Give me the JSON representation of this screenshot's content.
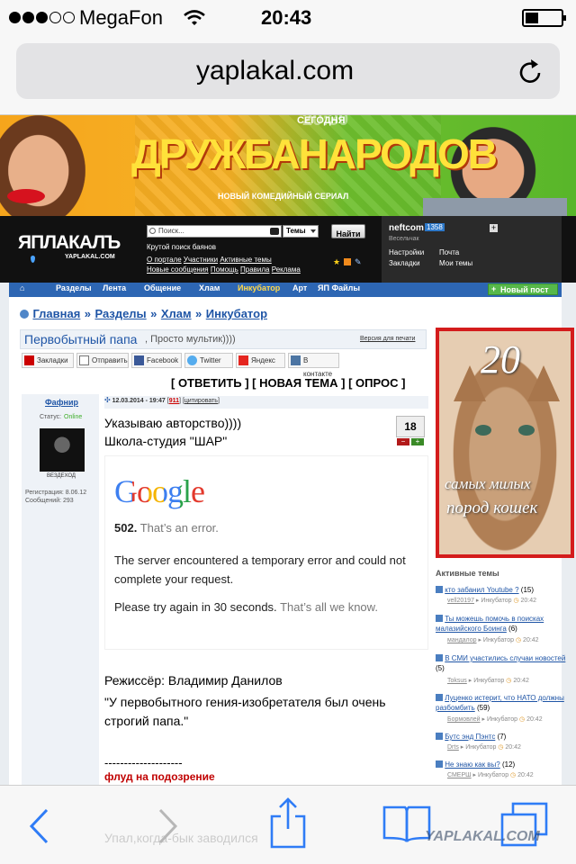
{
  "status_bar": {
    "carrier": "MegaFon",
    "time": "20:43"
  },
  "url_bar": {
    "domain": "yaplakal.com"
  },
  "banner": {
    "small_top": "20:30",
    "today": "СЕГОДНЯ",
    "title": "ДРУЖБАНАРОДОВ",
    "subtitle": "НОВЫЙ КОМЕДИЙНЫЙ СЕРИАЛ"
  },
  "header": {
    "logo": "ЯПЛАКАЛЪ",
    "logo_sub": "YAPLAKAL.COM",
    "search_placeholder": "Поиск...",
    "search_scope": "Темы",
    "search_button": "Найти",
    "search_tagline": "Крутой поиск баянов",
    "links_row1": [
      "О портале",
      "Участники",
      "Активные темы"
    ],
    "links_row2": [
      "Новые сообщения",
      "Помощь",
      "Правила",
      "Реклама"
    ],
    "user": {
      "name": "neftcom",
      "score": "1358",
      "rank": "Весельчак",
      "settings": "Настройки",
      "bookmarks": "Закладки",
      "mail": "Почта",
      "my_topics": "Мои темы"
    }
  },
  "nav": {
    "items": [
      "Разделы",
      "Лента",
      "Общение",
      "Хлам",
      "Инкубатор",
      "Арт",
      "ЯП Файлы"
    ],
    "new_post": "Новый пост"
  },
  "breadcrumb": {
    "items": [
      "Главная",
      "Разделы",
      "Хлам",
      "Инкубатор"
    ],
    "sep": "»"
  },
  "topic": {
    "title": "Первобытный папа",
    "subtitle": ", Просто мультик))))",
    "print_version": "Версия для печати",
    "share_buttons": [
      "Закладки",
      "Отправить",
      "Facebook",
      "Twitter",
      "Яндекс",
      "В контакте"
    ],
    "actions": "[ ОТВЕТИТЬ ] [ НОВАЯ ТЕМА ] [ ОПРОС ]"
  },
  "post": {
    "author": "Фафнир",
    "status_label": "Статус:",
    "status_value": "Online",
    "author_rank": "ВЕЗДЕХОД",
    "registration": "Регистрация: 8.06.12",
    "messages": "Сообщений: 293",
    "date": "12.03.2014 - 19:47",
    "post_id": "911",
    "quote_link": "цитировать",
    "rating": "18",
    "line1": "Указываю авторство))))",
    "line2": "Школа-студия \"ШАР\"",
    "error_logo": "Google",
    "error_code": "502.",
    "error_title": "That’s an error.",
    "error_text": "The server encountered a temporary error and could not complete your request.",
    "error_retry": "Please try again in 30 seconds.",
    "error_retry_tail": "That’s all we know.",
    "director": "Режиссёр: Владимир Данилов",
    "quote": "\"У первобытного гения-изобретателя был очень строгий папа.\"",
    "dashes": "--------------------",
    "flag": "флуд на подозрение",
    "faded_reply": "Упал,когда-бык заводился"
  },
  "side_ad": {
    "number": "20",
    "line1": "самых милых",
    "line2": "пород кошек"
  },
  "active_topics": {
    "heading": "Активные темы",
    "items": [
      {
        "title": "кто забанил Youtube ?",
        "count": "(15)",
        "user": "vell20197",
        "section": "Инкубатор",
        "time": "20:42"
      },
      {
        "title": "Ты можешь помочь в поисках малазийского Боинга",
        "count": "(6)",
        "user": "мандалор",
        "section": "Инкубатор",
        "time": "20:42"
      },
      {
        "title": "В СМИ участились случаи новостей",
        "count": "(5)",
        "user": "Toksus",
        "section": "Инкубатор",
        "time": "20:42"
      },
      {
        "title": "Луценко истерит, что НАТО должны разбомбить",
        "count": "(59)",
        "user": "Бормовлей",
        "section": "Инкубатор",
        "time": "20:42"
      },
      {
        "title": "Бутс энд Пэнтс",
        "count": "(7)",
        "user": "Drts",
        "section": "Инкубатор",
        "time": "20:42"
      },
      {
        "title": "Не знаю как вы?",
        "count": "(12)",
        "user": "СМЕРШ",
        "section": "Инкубатор",
        "time": "20:42"
      }
    ]
  },
  "footer_watermark": "YAPLAKAL.COM",
  "colors": {
    "link": "#1f55a6",
    "nav": "#2d66b3",
    "accent": "#c00000",
    "ios_blue": "#2f7cf6"
  }
}
